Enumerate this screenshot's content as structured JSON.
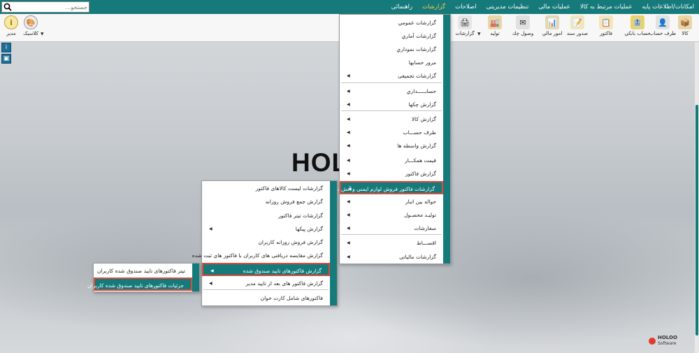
{
  "menubar": {
    "items": [
      "امکانات/اطلاعات پایه",
      "عملیات مرتبط به کالا",
      "عملیات مالی",
      "تنظیمات مدیریتی",
      "اصلاحات",
      "گزارشات",
      "راهنمائی"
    ],
    "active": "گزارشات"
  },
  "search": {
    "placeholder": "جستجو..."
  },
  "toolbar": {
    "kala": "کالا",
    "taraf_hesab": "طرف حساب",
    "hesab_banki": "حساب بانکي",
    "factor": "فاکتور",
    "sodor_sanad": "صدور سند",
    "omur_mali": "امور مالي",
    "vosul_chek": "وصول چك",
    "tolid": "توليد",
    "gozareshat": "گزارشات",
    "modir": "مدیر",
    "classic": "کلاسیک"
  },
  "brand": {
    "big": "HOLO",
    "logo_line1": "HOLOO",
    "logo_line2": "Software"
  },
  "menu1": {
    "items": [
      {
        "label": "گزارشات عمومي",
        "arrow": false
      },
      {
        "label": "گزارشات آماري",
        "arrow": false
      },
      {
        "label": "گزارشات نموداري",
        "arrow": false
      },
      {
        "label": "مرور حسابها",
        "arrow": false
      },
      {
        "label": "گزارشات تجمیعی",
        "arrow": true
      },
      {
        "label": "حسابـــــداري",
        "arrow": true
      },
      {
        "label": "گزارش چكها",
        "arrow": true
      },
      {
        "label": "گزارش كالا",
        "arrow": true
      },
      {
        "label": "طرف حســـاب",
        "arrow": true
      },
      {
        "label": "گزارش واسطه ها",
        "arrow": true
      },
      {
        "label": "قيمت همكـــار",
        "arrow": true
      },
      {
        "label": "گزارش فاکتور",
        "arrow": true
      },
      {
        "label": "گزارشات فاکتور فروش لوازم ایمنی و آتش نشانی",
        "arrow": true
      },
      {
        "label": "حواله بين انبار",
        "arrow": true
      },
      {
        "label": "توليـد محصـول",
        "arrow": true
      },
      {
        "label": "سفارشات",
        "arrow": true
      },
      {
        "label": "اقســـاط",
        "arrow": true
      },
      {
        "label": "گزارشات مالیاتی",
        "arrow": true
      }
    ]
  },
  "menu2": {
    "items": [
      {
        "label": "گزارشات لیست کالاهای فاکتور",
        "arrow": false
      },
      {
        "label": "گزارش جمع فروش روزانه",
        "arrow": false
      },
      {
        "label": "گزارشات تیتر فاکتور",
        "arrow": false
      },
      {
        "label": "گزارش پیکها",
        "arrow": true
      },
      {
        "label": "گزارش فروش روزانه کاربران",
        "arrow": false
      },
      {
        "label": "گزارش مقایسه دریافتی های  کاربران با فاکتور های ثبت شده",
        "arrow": false
      },
      {
        "label": "گزارش فاکتورهای تایید صندوق شده",
        "arrow": true
      },
      {
        "label": "گزارش فاکتور های بعد از تایید مدیر",
        "arrow": true
      },
      {
        "label": "فاکتورهای شامل کارت خوان",
        "arrow": false
      }
    ]
  },
  "menu3": {
    "items": [
      {
        "label": "تیتر فاکتورهای تایید صندوق شده کاربران",
        "arrow": false
      },
      {
        "label": "جزئیات فاکتورهای تایید صندوق شده کاربران",
        "arrow": false
      }
    ]
  }
}
